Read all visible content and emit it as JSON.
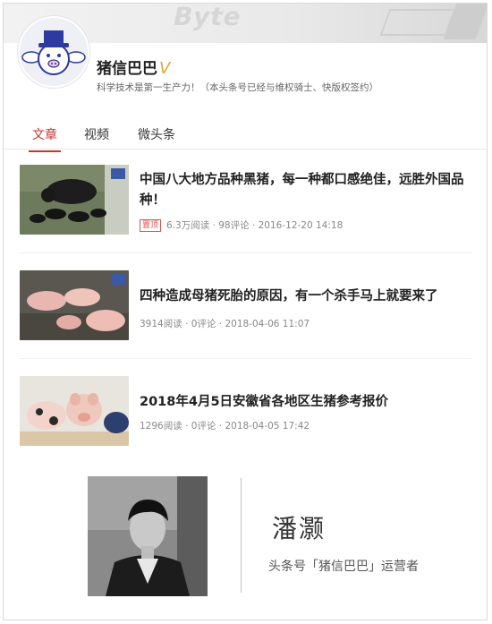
{
  "profile": {
    "name": "猪信巴巴",
    "verified_mark": "V",
    "description": "科学技术是第一生产力！（本头条号已经与维权骑士、快版权签约）",
    "banner_watermark": "Byte"
  },
  "tabs": [
    {
      "label": "文章",
      "active": true
    },
    {
      "label": "视频",
      "active": false
    },
    {
      "label": "微头条",
      "active": false
    }
  ],
  "articles": [
    {
      "title": "中国八大地方品种黑猪，每一种都口感绝佳，远胜外国品种！",
      "badge": "置顶",
      "reads": "6.3万阅读",
      "comments": "98评论",
      "date": "2016-12-20 14:18"
    },
    {
      "title": "四种造成母猪死胎的原因，有一个杀手马上就要来了",
      "reads": "3914阅读",
      "comments": "0评论",
      "date": "2018-04-06 11:07"
    },
    {
      "title": "2018年4月5日安徽省各地区生猪参考报价",
      "reads": "1296阅读",
      "comments": "0评论",
      "date": "2018-04-05 17:42"
    }
  ],
  "operator": {
    "name": "潘灏",
    "role": "头条号「猪信巴巴」运营者"
  },
  "colors": {
    "accent": "#c7352f",
    "verified": "#d9a83a"
  }
}
